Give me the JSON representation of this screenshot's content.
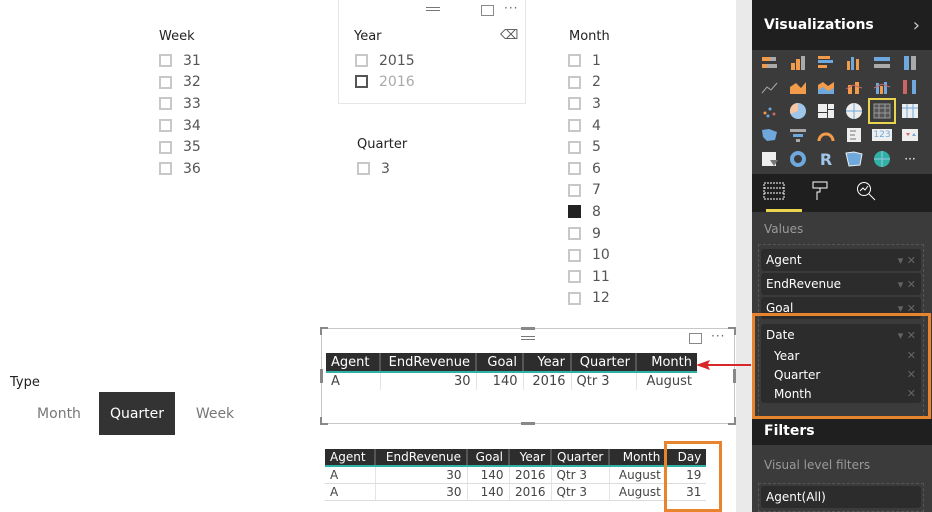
{
  "slicers": {
    "week": {
      "title": "Week",
      "items": [
        "31",
        "32",
        "33",
        "34",
        "35",
        "36"
      ]
    },
    "year": {
      "title": "Year",
      "items": [
        "2015",
        "2016"
      ],
      "clear_icon": "eraser-icon"
    },
    "quarter": {
      "title": "Quarter",
      "items": [
        "3"
      ]
    },
    "month": {
      "title": "Month",
      "items": [
        "1",
        "2",
        "3",
        "4",
        "5",
        "6",
        "7",
        "8",
        "9",
        "10",
        "11",
        "12"
      ],
      "selected": "8"
    }
  },
  "type_slicer": {
    "title": "Type",
    "options": [
      "Month",
      "Quarter",
      "Week"
    ],
    "selected": "Quarter"
  },
  "table_main": {
    "columns": [
      "Agent",
      "EndRevenue",
      "Goal",
      "Year",
      "Quarter",
      "Month"
    ],
    "rows": [
      [
        "A",
        "30",
        "140",
        "2016",
        "Qtr 3",
        "August"
      ]
    ]
  },
  "table_detail": {
    "columns": [
      "Agent",
      "EndRevenue",
      "Goal",
      "Year",
      "Quarter",
      "Month",
      "Day"
    ],
    "rows": [
      [
        "A",
        "30",
        "140",
        "2016",
        "Qtr 3",
        "August",
        "19"
      ],
      [
        "A",
        "30",
        "140",
        "2016",
        "Qtr 3",
        "August",
        "31"
      ]
    ]
  },
  "visual_header": {
    "more": "···"
  },
  "panel": {
    "title": "Visualizations",
    "chevron": "›",
    "values_label": "Values",
    "fields": [
      "Agent",
      "EndRevenue",
      "Goal"
    ],
    "date_field": {
      "label": "Date",
      "children": [
        "Year",
        "Quarter",
        "Month"
      ]
    },
    "filters_title": "Filters",
    "visual_filters_label": "Visual level filters",
    "filter_items": [
      "Agent(All)"
    ],
    "more_visuals": "···",
    "r_visual": "R",
    "card_visual": "123"
  },
  "colors": {
    "accent_orange": "#e8832e",
    "teal": "#2fb1a6",
    "highlight_yellow": "#e8d44d",
    "arrow_red": "#d9262b"
  }
}
